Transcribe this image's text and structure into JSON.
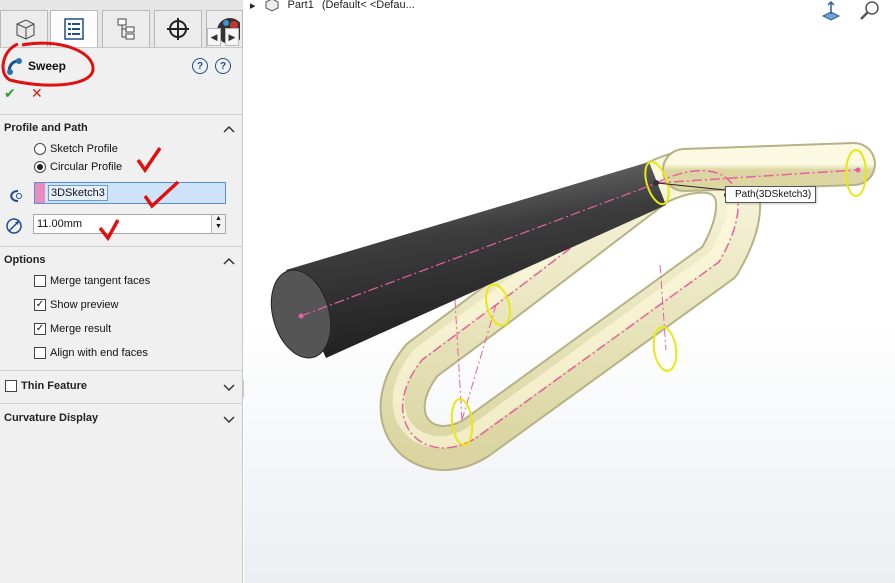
{
  "feature": {
    "title": "Sweep"
  },
  "actions": {
    "ok_symbol": "✔",
    "cancel_symbol": "✕",
    "help_1": "?",
    "help_2": "?"
  },
  "profile_and_path": {
    "title": "Profile and Path",
    "radio_sketch": "Sketch Profile",
    "radio_circular": "Circular Profile",
    "path_value": "3DSketch3",
    "diameter_value": "11.00mm"
  },
  "options": {
    "title": "Options",
    "items": [
      {
        "label": "Merge tangent faces",
        "checked": false,
        "mark": ""
      },
      {
        "label": "Show preview",
        "checked": true,
        "mark": "✓"
      },
      {
        "label": "Merge result",
        "checked": true,
        "mark": "✓"
      },
      {
        "label": "Align with end faces",
        "checked": false,
        "mark": ""
      }
    ]
  },
  "thin_feature": {
    "title": "Thin Feature"
  },
  "curvature_display": {
    "title": "Curvature Display"
  },
  "viewport": {
    "part_name": "Part1",
    "config_text": "(Default< <Defau...",
    "callout": "Path(3DSketch3)"
  },
  "icons": [
    "part-icon",
    "property-manager-icon",
    "configuration-manager-icon",
    "dimxpert-icon",
    "appearance-icon",
    "sweep-icon",
    "path-icon",
    "diameter-icon",
    "view-orientation-icon",
    "zoom-icon"
  ],
  "colors": {
    "accent_blue": "#1f4e8a",
    "path_pink": "#e88cc0",
    "profile_yellow": "#e8e812",
    "tube_fill": "#eeebbf",
    "ok_green": "#2e9a2e",
    "cancel_red": "#d0201c",
    "annotation_red": "#e01010"
  }
}
